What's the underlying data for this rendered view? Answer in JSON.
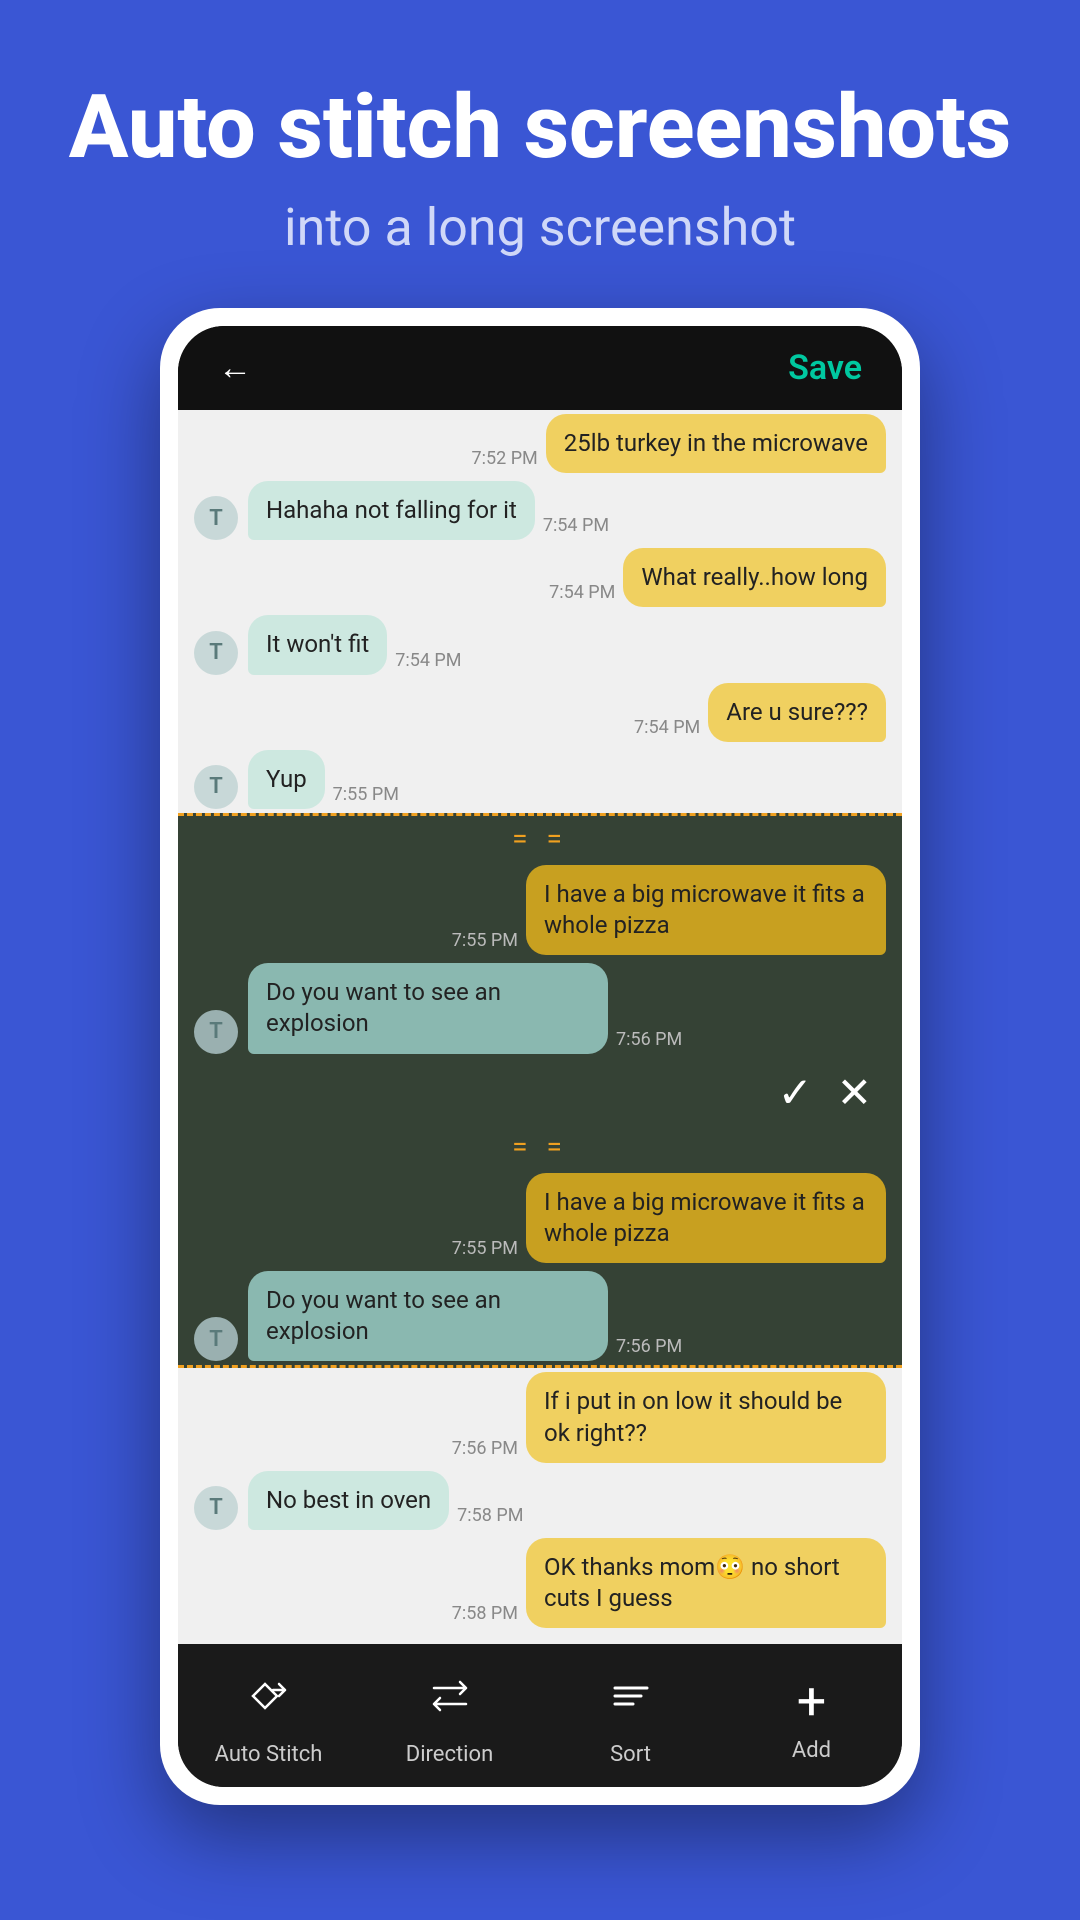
{
  "header": {
    "title": "Auto stitch screenshots",
    "subtitle": "into a long screenshot"
  },
  "phone": {
    "topbar": {
      "back_label": "←",
      "save_label": "Save"
    },
    "messages": [
      {
        "id": 1,
        "type": "outgoing",
        "text": "25lb turkey in the microwave",
        "time": "7:52 PM",
        "overlap": false,
        "section": "top"
      },
      {
        "id": 2,
        "type": "incoming",
        "avatar": "T",
        "text": "Hahaha not falling for it",
        "time": "7:54 PM",
        "overlap": false,
        "section": "normal"
      },
      {
        "id": 3,
        "type": "outgoing",
        "text": "What really..how long",
        "time": "7:54 PM",
        "overlap": false,
        "section": "normal"
      },
      {
        "id": 4,
        "type": "incoming",
        "avatar": "T",
        "text": "It won't fit",
        "time": "7:54 PM",
        "overlap": false,
        "section": "normal"
      },
      {
        "id": 5,
        "type": "outgoing",
        "text": "Are u sure???",
        "time": "7:54 PM",
        "overlap": false,
        "section": "normal"
      },
      {
        "id": 6,
        "type": "incoming",
        "avatar": "T",
        "text": "Yup",
        "time": "7:55 PM",
        "overlap": false,
        "section": "normal"
      },
      {
        "id": 7,
        "type": "outgoing",
        "text": "I have a big microwave it fits a whole pizza",
        "time": "7:55 PM",
        "overlap": true,
        "section": "overlap1"
      },
      {
        "id": 8,
        "type": "incoming",
        "avatar": "T",
        "text": "Do you want to see an explosion",
        "time": "7:56 PM",
        "overlap": true,
        "section": "overlap1"
      },
      {
        "id": 9,
        "type": "outgoing",
        "text": "I have a big microwave it fits a whole pizza",
        "time": "7:55 PM",
        "overlap": true,
        "section": "overlap2"
      },
      {
        "id": 10,
        "type": "incoming",
        "avatar": "T",
        "text": "Do you want to see an explosion",
        "time": "7:56 PM",
        "overlap": true,
        "section": "overlap2"
      },
      {
        "id": 11,
        "type": "outgoing",
        "text": "If i put in on low it should be ok right??",
        "time": "7:56 PM",
        "overlap": false,
        "section": "normal2"
      },
      {
        "id": 12,
        "type": "incoming",
        "avatar": "T",
        "text": "No best in oven",
        "time": "7:58 PM",
        "overlap": false,
        "section": "normal2"
      },
      {
        "id": 13,
        "type": "outgoing",
        "text": "OK thanks mom😳 no short cuts I guess",
        "time": "7:58 PM",
        "overlap": false,
        "section": "normal2"
      }
    ],
    "controls": {
      "check": "✓",
      "close": "✕"
    }
  },
  "toolbar": {
    "items": [
      {
        "id": "auto-stitch",
        "icon": "✦",
        "label": "Auto Stitch"
      },
      {
        "id": "direction",
        "icon": "⇄",
        "label": "Direction"
      },
      {
        "id": "sort",
        "icon": "≡",
        "label": "Sort"
      },
      {
        "id": "add",
        "icon": "+",
        "label": "Add"
      }
    ]
  }
}
